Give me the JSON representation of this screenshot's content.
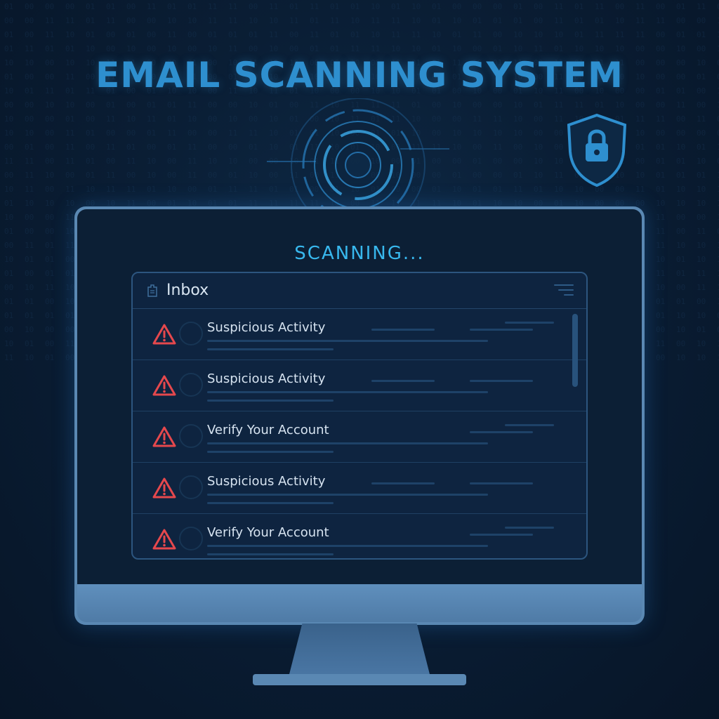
{
  "header": {
    "title": "EMAIL SCANNING SYSTEM"
  },
  "scan": {
    "status": "SCANNING..."
  },
  "inbox": {
    "title": "Inbox",
    "emails": [
      {
        "subject": "Suspicious Activity",
        "icon": "warning-icon"
      },
      {
        "subject": "Suspicious Activity",
        "icon": "warning-icon"
      },
      {
        "subject": "Verify Your Account",
        "icon": "warning-icon"
      },
      {
        "subject": "Suspicious Activity",
        "icon": "warning-icon"
      },
      {
        "subject": "Verify Your Account",
        "icon": "warning-icon"
      }
    ]
  },
  "colors": {
    "accent": "#2e8fcf",
    "scanning": "#38b8ee",
    "warning": "#e5484d",
    "background": "#0a1e35"
  },
  "icons": {
    "security": "shield-lock-icon",
    "scanner": "radar-scanner-icon",
    "inbox": "inbox-icon",
    "menu": "menu-icon"
  }
}
